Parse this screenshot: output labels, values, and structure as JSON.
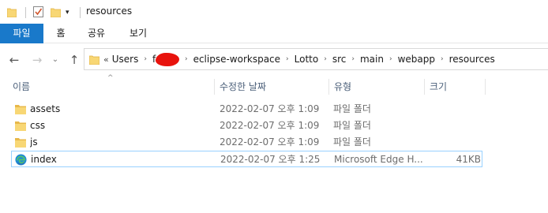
{
  "window": {
    "title": "resources",
    "quick_access": {
      "dropdown_glyph": "▾"
    }
  },
  "ribbon": {
    "tabs": [
      {
        "label": "파일",
        "active": true
      },
      {
        "label": "홈"
      },
      {
        "label": "공유"
      },
      {
        "label": "보기"
      }
    ]
  },
  "nav": {
    "back_glyph": "←",
    "forward_glyph": "→",
    "recent_glyph": "⌄",
    "up_glyph": "↑",
    "overflow": "«",
    "path": [
      "Users",
      "f",
      "eclipse-workspace",
      "Lotto",
      "src",
      "main",
      "webapp",
      "resources"
    ],
    "separator": "›"
  },
  "columns": {
    "name": "이름",
    "date": "수정한 날짜",
    "type": "유형",
    "size": "크기",
    "sort_glyph": "^"
  },
  "files": [
    {
      "name": "assets",
      "date": "2022-02-07 오후 1:09",
      "type": "파일 폴더",
      "size": "",
      "icon": "folder-icon"
    },
    {
      "name": "css",
      "date": "2022-02-07 오후 1:09",
      "type": "파일 폴더",
      "size": "",
      "icon": "folder-icon"
    },
    {
      "name": "js",
      "date": "2022-02-07 오후 1:09",
      "type": "파일 폴더",
      "size": "",
      "icon": "folder-icon"
    },
    {
      "name": "index",
      "date": "2022-02-07 오후 1:25",
      "type": "Microsoft Edge H...",
      "size": "41KB",
      "icon": "edge-icon",
      "selected": true
    }
  ],
  "colors": {
    "accent": "#1979ca",
    "folder": "#f8d775",
    "folder_dark": "#e8b84a",
    "selection_border": "#99d1ff",
    "redaction": "#e8130d"
  }
}
